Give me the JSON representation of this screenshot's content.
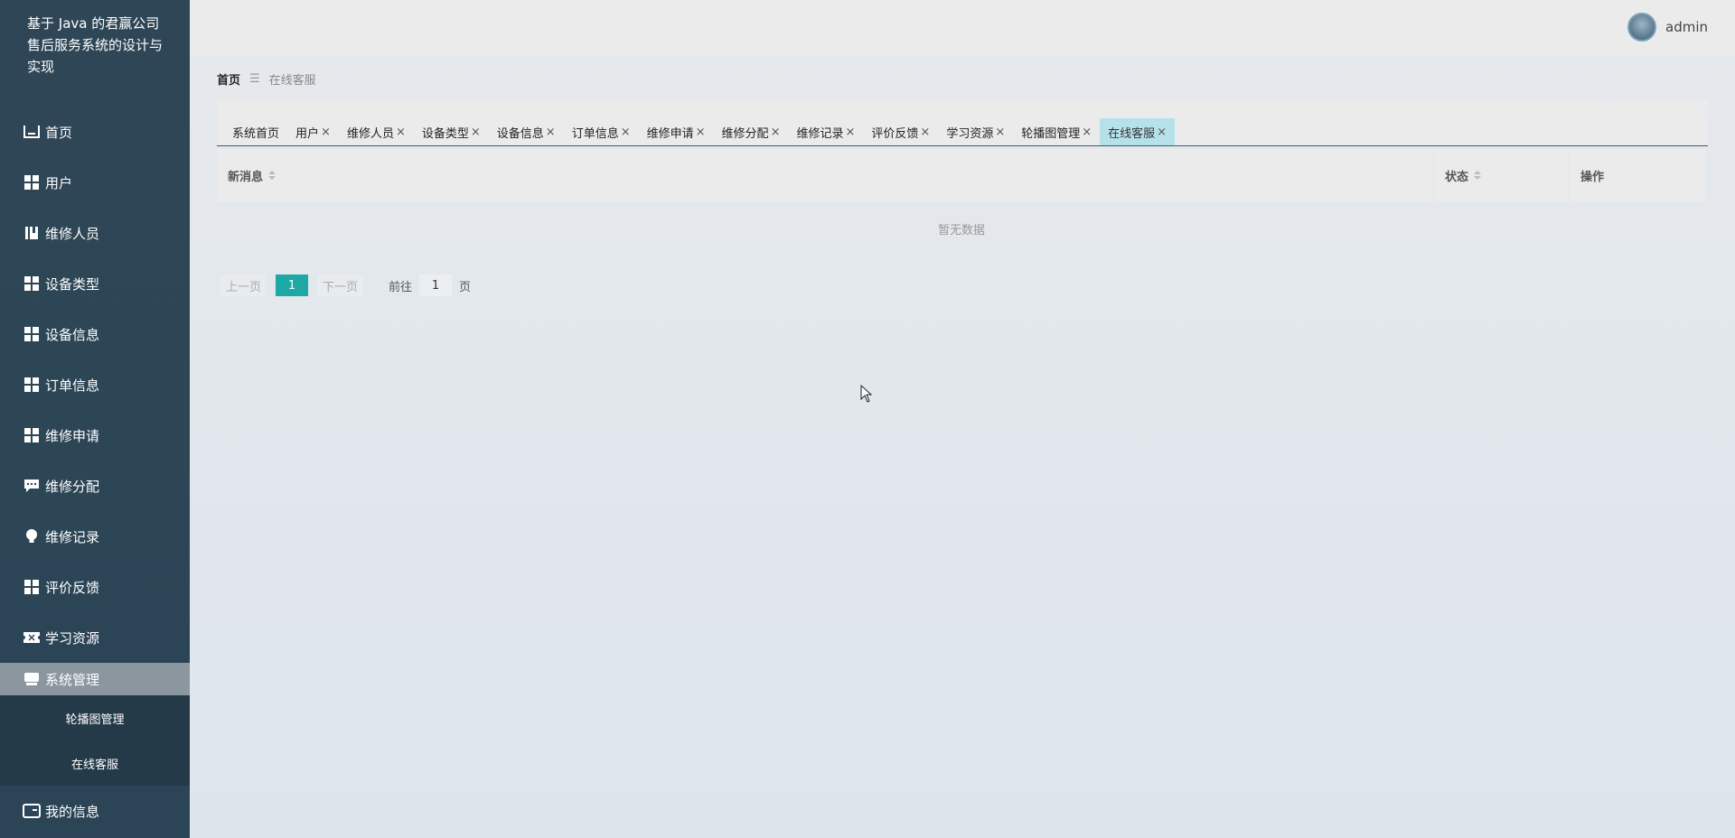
{
  "sidebar": {
    "title": "基于 Java 的君赢公司售后服务系统的设计与实现",
    "items": [
      {
        "label": "首页",
        "icon": "home-icon"
      },
      {
        "label": "用户",
        "icon": "grid-icon"
      },
      {
        "label": "维修人员",
        "icon": "book-icon"
      },
      {
        "label": "设备类型",
        "icon": "grid-icon"
      },
      {
        "label": "设备信息",
        "icon": "grid-icon"
      },
      {
        "label": "订单信息",
        "icon": "grid-icon"
      },
      {
        "label": "维修申请",
        "icon": "grid-icon"
      },
      {
        "label": "维修分配",
        "icon": "chat-icon"
      },
      {
        "label": "维修记录",
        "icon": "bulb-icon"
      },
      {
        "label": "评价反馈",
        "icon": "grid-icon"
      },
      {
        "label": "学习资源",
        "icon": "ticket-icon"
      }
    ],
    "active_group": {
      "label": "系统管理",
      "icon": "monitor-icon"
    },
    "sub_items": [
      "轮播图管理",
      "在线客服"
    ],
    "last_item": {
      "label": "我的信息",
      "icon": "card-icon"
    }
  },
  "header": {
    "username": "admin"
  },
  "breadcrumb": {
    "home": "首页",
    "separator": "☰",
    "current": "在线客服"
  },
  "tags": [
    {
      "label": "系统首页",
      "closable": false
    },
    {
      "label": "用户",
      "closable": true
    },
    {
      "label": "维修人员",
      "closable": true
    },
    {
      "label": "设备类型",
      "closable": true
    },
    {
      "label": "设备信息",
      "closable": true
    },
    {
      "label": "订单信息",
      "closable": true
    },
    {
      "label": "维修申请",
      "closable": true
    },
    {
      "label": "维修分配",
      "closable": true
    },
    {
      "label": "维修记录",
      "closable": true
    },
    {
      "label": "评价反馈",
      "closable": true
    },
    {
      "label": "学习资源",
      "closable": true
    },
    {
      "label": "轮播图管理",
      "closable": true
    },
    {
      "label": "在线客服",
      "closable": true,
      "active": true
    }
  ],
  "table": {
    "columns": [
      "新消息",
      "状态",
      "操作"
    ],
    "empty_text": "暂无数据"
  },
  "pagination": {
    "prev": "上一页",
    "current": "1",
    "next": "下一页",
    "goto_label": "前往",
    "goto_value": "1",
    "page_unit": "页"
  },
  "colors": {
    "sidebar": "#2e4656",
    "accent": "#1da7a5",
    "active_tag": "#b6e1ea"
  }
}
